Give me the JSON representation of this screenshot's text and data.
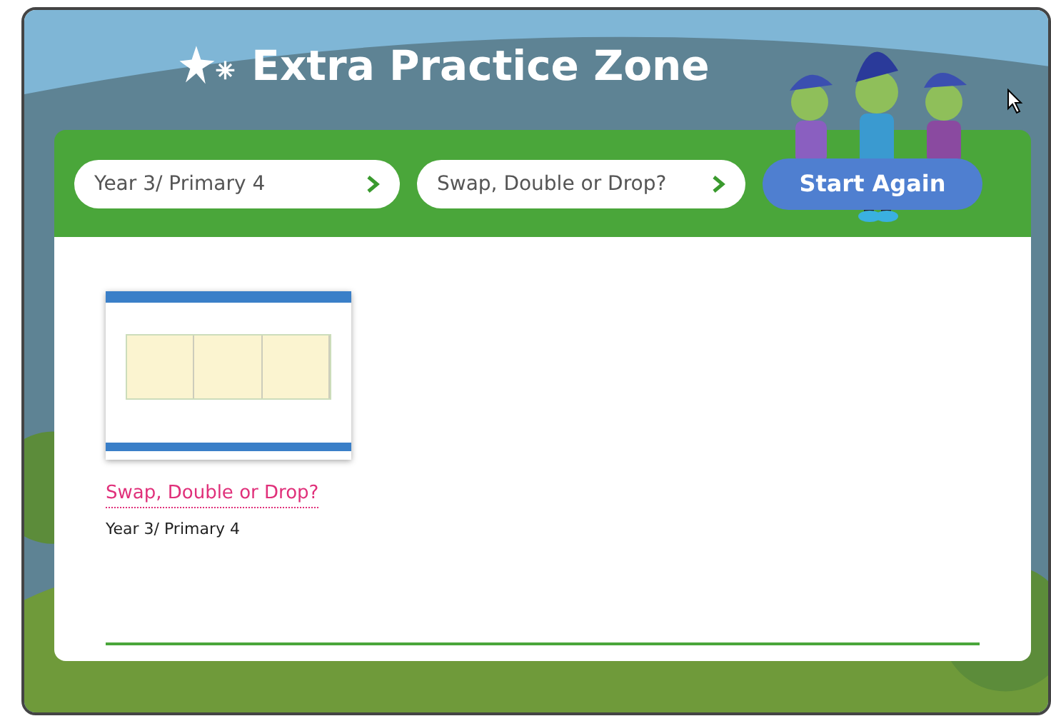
{
  "header": {
    "title": "Extra Practice Zone"
  },
  "filters": [
    {
      "label": "Year 3/ Primary 4",
      "kind": "dropdown"
    },
    {
      "label": "Swap, Double or Drop?",
      "kind": "dropdown"
    },
    {
      "label": "Start Again",
      "kind": "button"
    }
  ],
  "activities": [
    {
      "title": "Swap, Double or Drop?",
      "subtitle": "Year 3/ Primary 4"
    }
  ]
}
